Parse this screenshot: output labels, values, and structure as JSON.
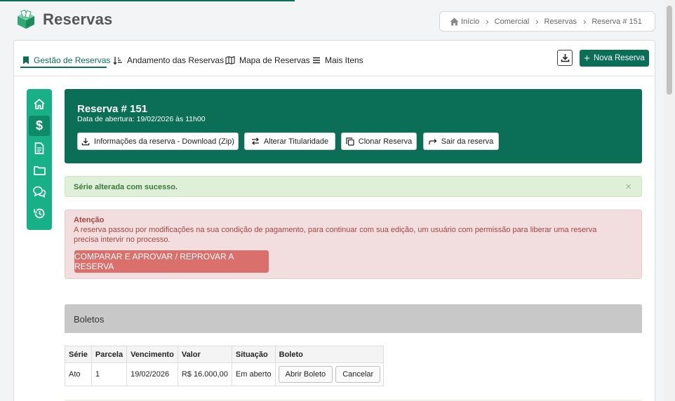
{
  "app": {
    "title": "Reservas"
  },
  "breadcrumb": {
    "items": [
      "Início",
      "Comercial",
      "Reservas",
      "Reserva # 151"
    ]
  },
  "tabs": [
    {
      "label": "Gestão de Reservas",
      "icon": "bookmark-icon",
      "active": true
    },
    {
      "label": "Andamento das Reservas",
      "icon": "sort-icon"
    },
    {
      "label": "Mapa de Reservas",
      "icon": "map-icon"
    },
    {
      "label": "Mais Itens",
      "icon": "menu-icon"
    }
  ],
  "toolbar": {
    "new_label": "Nova Reserva"
  },
  "sidenav": [
    "home-icon",
    "dollar-icon",
    "document-icon",
    "folder-icon",
    "chat-icon",
    "history-icon"
  ],
  "reservation": {
    "title": "Reserva # 151",
    "opened": "Data de abertura: 19/02/2026 às 11h00",
    "buttons": {
      "download": "Informações da reserva - Download (Zip)",
      "change": "Alterar Titularidade",
      "clone": "Clonar Reserva",
      "exit": "Sair da reserva"
    }
  },
  "alerts": {
    "success": "Série alterada com sucesso.",
    "close": "×",
    "danger_title": "Atenção",
    "danger_body": "A reserva passou por modificações na sua condição de pagamento, para continuar com sua edição, um usuário com permissão para liberar uma reserva precisa intervir no processo.",
    "danger_action": "COMPARAR E APROVAR / REPROVAR A RESERVA"
  },
  "boletos": {
    "title": "Boletos",
    "headers": [
      "Série",
      "Parcela",
      "Vencimento",
      "Valor",
      "Situação",
      "Boleto"
    ],
    "rows": [
      {
        "serie": "Ato",
        "parcela": "1",
        "vencimento": "19/02/2026",
        "valor": "R$ 16.000,00",
        "situacao": "Em aberto"
      }
    ],
    "open_label": "Abrir Boleto",
    "cancel_label": "Cancelar"
  },
  "colors": {
    "primary": "#0b6e57",
    "sidenav": "#17b087",
    "danger": "#d9706b"
  }
}
